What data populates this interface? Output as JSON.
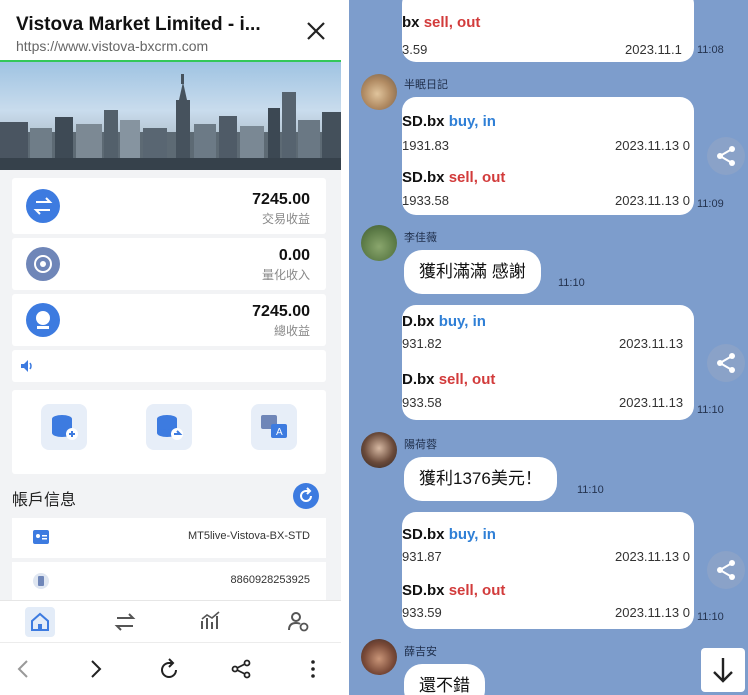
{
  "left": {
    "header": {
      "title": "Vistova Market Limited - i...",
      "url": "https://www.vistova-bxcrm.com"
    },
    "stats": [
      {
        "value": "7245.00",
        "label": "交易收益",
        "icon": "swap-icon",
        "color": "#3d7be0"
      },
      {
        "value": "0.00",
        "label": "量化收入",
        "icon": "chart-circle-icon",
        "color": "#6f86b8"
      },
      {
        "value": "7245.00",
        "label": "總收益",
        "icon": "coin-icon",
        "color": "#3d7be0"
      }
    ],
    "quick_actions": [
      "database-in-icon",
      "database-out-icon",
      "translate-icon"
    ],
    "account": {
      "title": "帳戶信息",
      "rows": [
        {
          "icon": "id-card-icon",
          "value": "MT5live-Vistova-BX-STD"
        },
        {
          "icon": "phone-icon",
          "value": "8860928253925"
        }
      ]
    },
    "tabs": [
      "home-icon",
      "transfer-icon",
      "market-chart-icon",
      "user-settings-icon"
    ],
    "browser": [
      "back-icon",
      "forward-icon",
      "reload-icon",
      "share-icon",
      "more-icon"
    ]
  },
  "right": {
    "messages": [
      {
        "type": "trade-partial",
        "lines": [
          {
            "sym": "bx",
            "action": "sell, out",
            "kind": "sell",
            "num": "3.59",
            "date": "2023.11.1"
          }
        ],
        "time": "11:08"
      },
      {
        "sender": "半眠日記",
        "type": "trade",
        "lines": [
          {
            "sym": "SD.bx",
            "action": "buy, in",
            "kind": "buy",
            "num": "1931.83",
            "date": "2023.11.13 0"
          },
          {
            "sym": "SD.bx",
            "action": "sell, out",
            "kind": "sell",
            "num": "1933.58",
            "date": "2023.11.13 0"
          }
        ],
        "time": "11:09"
      },
      {
        "sender": "李佳薇",
        "type": "text",
        "text": "獲利滿滿 感謝",
        "time": "11:10"
      },
      {
        "type": "trade",
        "lines": [
          {
            "sym": "D.bx",
            "action": "buy, in",
            "kind": "buy",
            "num": "931.82",
            "date": "2023.11.13"
          },
          {
            "sym": "D.bx",
            "action": "sell, out",
            "kind": "sell",
            "num": "933.58",
            "date": "2023.11.13"
          }
        ],
        "time": "11:10"
      },
      {
        "sender": "陽荷蓉",
        "type": "text",
        "text": "獲利1376美元！",
        "time": "11:10"
      },
      {
        "type": "trade",
        "lines": [
          {
            "sym": "SD.bx",
            "action": "buy, in",
            "kind": "buy",
            "num": "931.87",
            "date": "2023.11.13 0"
          },
          {
            "sym": "SD.bx",
            "action": "sell, out",
            "kind": "sell",
            "num": "933.59",
            "date": "2023.11.13 0"
          }
        ],
        "time": "11:10"
      },
      {
        "sender": "薛吉安",
        "type": "text",
        "text": "還不錯",
        "time": ""
      }
    ],
    "colors": {
      "chat_bg": "#7d9dcc",
      "buy": "#2f7fd6",
      "sell": "#d23b3b"
    }
  }
}
